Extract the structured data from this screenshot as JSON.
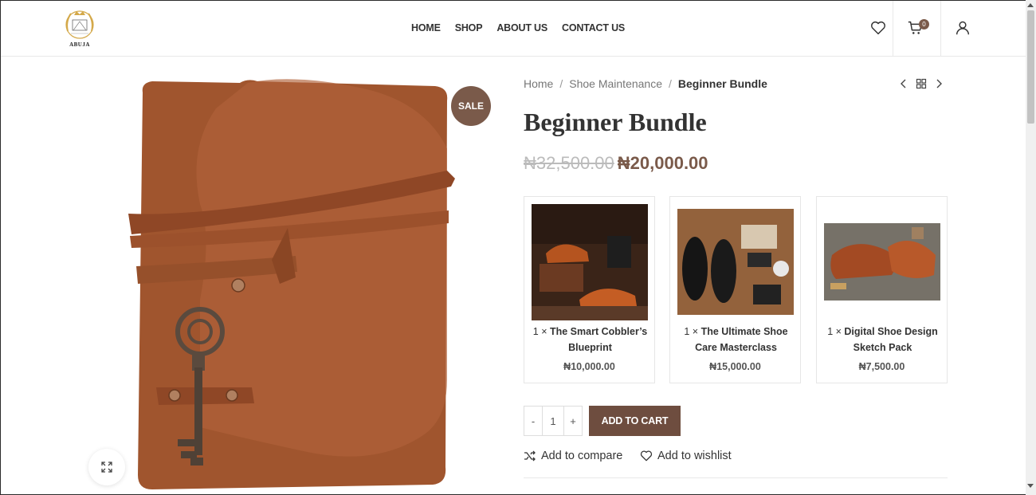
{
  "brand": {
    "logo_text": "ABUJA"
  },
  "nav": [
    {
      "label": "HOME"
    },
    {
      "label": "SHOP"
    },
    {
      "label": "ABOUT US"
    },
    {
      "label": "CONTACT US"
    }
  ],
  "header": {
    "cart_count": "0"
  },
  "product": {
    "sale_badge": "SALE",
    "breadcrumb": {
      "home": "Home",
      "separator": "/",
      "category": "Shoe Maintenance",
      "current": "Beginner Bundle"
    },
    "title": "Beginner Bundle",
    "price_old": "₦32,500.00",
    "price_new": "₦20,000.00",
    "bundle": [
      {
        "qty": "1 ×",
        "name": "The Smart Cobbler’s Blueprint",
        "price": "₦10,000.00"
      },
      {
        "qty": "1 ×",
        "name": "The Ultimate Shoe Care Masterclass",
        "price": "₦15,000.00"
      },
      {
        "qty": "1 ×",
        "name": "Digital Shoe Design Sketch Pack",
        "price": "₦7,500.00"
      }
    ],
    "quantity": {
      "minus": "-",
      "value": "1",
      "plus": "+"
    },
    "add_to_cart": "ADD TO CART",
    "compare_label": "Add to compare",
    "wishlist_label": "Add to wishlist"
  },
  "colors": {
    "accent": "#7a5a4a",
    "button": "#6e4d3f",
    "leather": "#a0552e"
  }
}
